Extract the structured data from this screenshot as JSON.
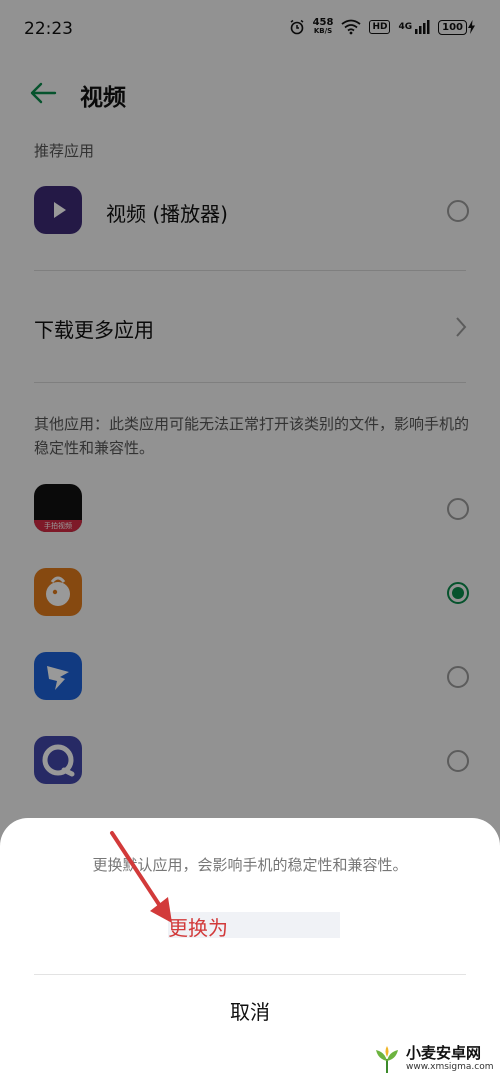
{
  "status_bar": {
    "time": "22:23",
    "net_speed_value": "458",
    "net_speed_unit": "KB/S",
    "hd_label": "HD",
    "signal_label": "4G",
    "battery": "100"
  },
  "header": {
    "title": "视频"
  },
  "recommended": {
    "label": "推荐应用",
    "app_name": "视频 (播放器)",
    "selected": false
  },
  "more_apps": {
    "label": "下载更多应用"
  },
  "other_apps": {
    "note": "其他应用：此类应用可能无法正常打开该类别的文件，影响手机的稳定性和兼容性。",
    "items": [
      {
        "icon": "shortvideo-app-icon",
        "caption": "手拍视频",
        "selected": false
      },
      {
        "icon": "squirrel-app-icon",
        "selected": true
      },
      {
        "icon": "ding-app-icon",
        "selected": false
      },
      {
        "icon": "circle-app-icon",
        "selected": false
      }
    ]
  },
  "dialog": {
    "message": "更换默认应用，会影响手机的稳定性和兼容性。",
    "replace_label": "更换为",
    "cancel_label": "取消"
  },
  "watermark": {
    "title": "小麦安卓网",
    "url": "www.xmsigma.com"
  },
  "colors": {
    "accent": "#0a8a4b",
    "annotation": "#d23a3a",
    "sheet": "#ffffff"
  }
}
